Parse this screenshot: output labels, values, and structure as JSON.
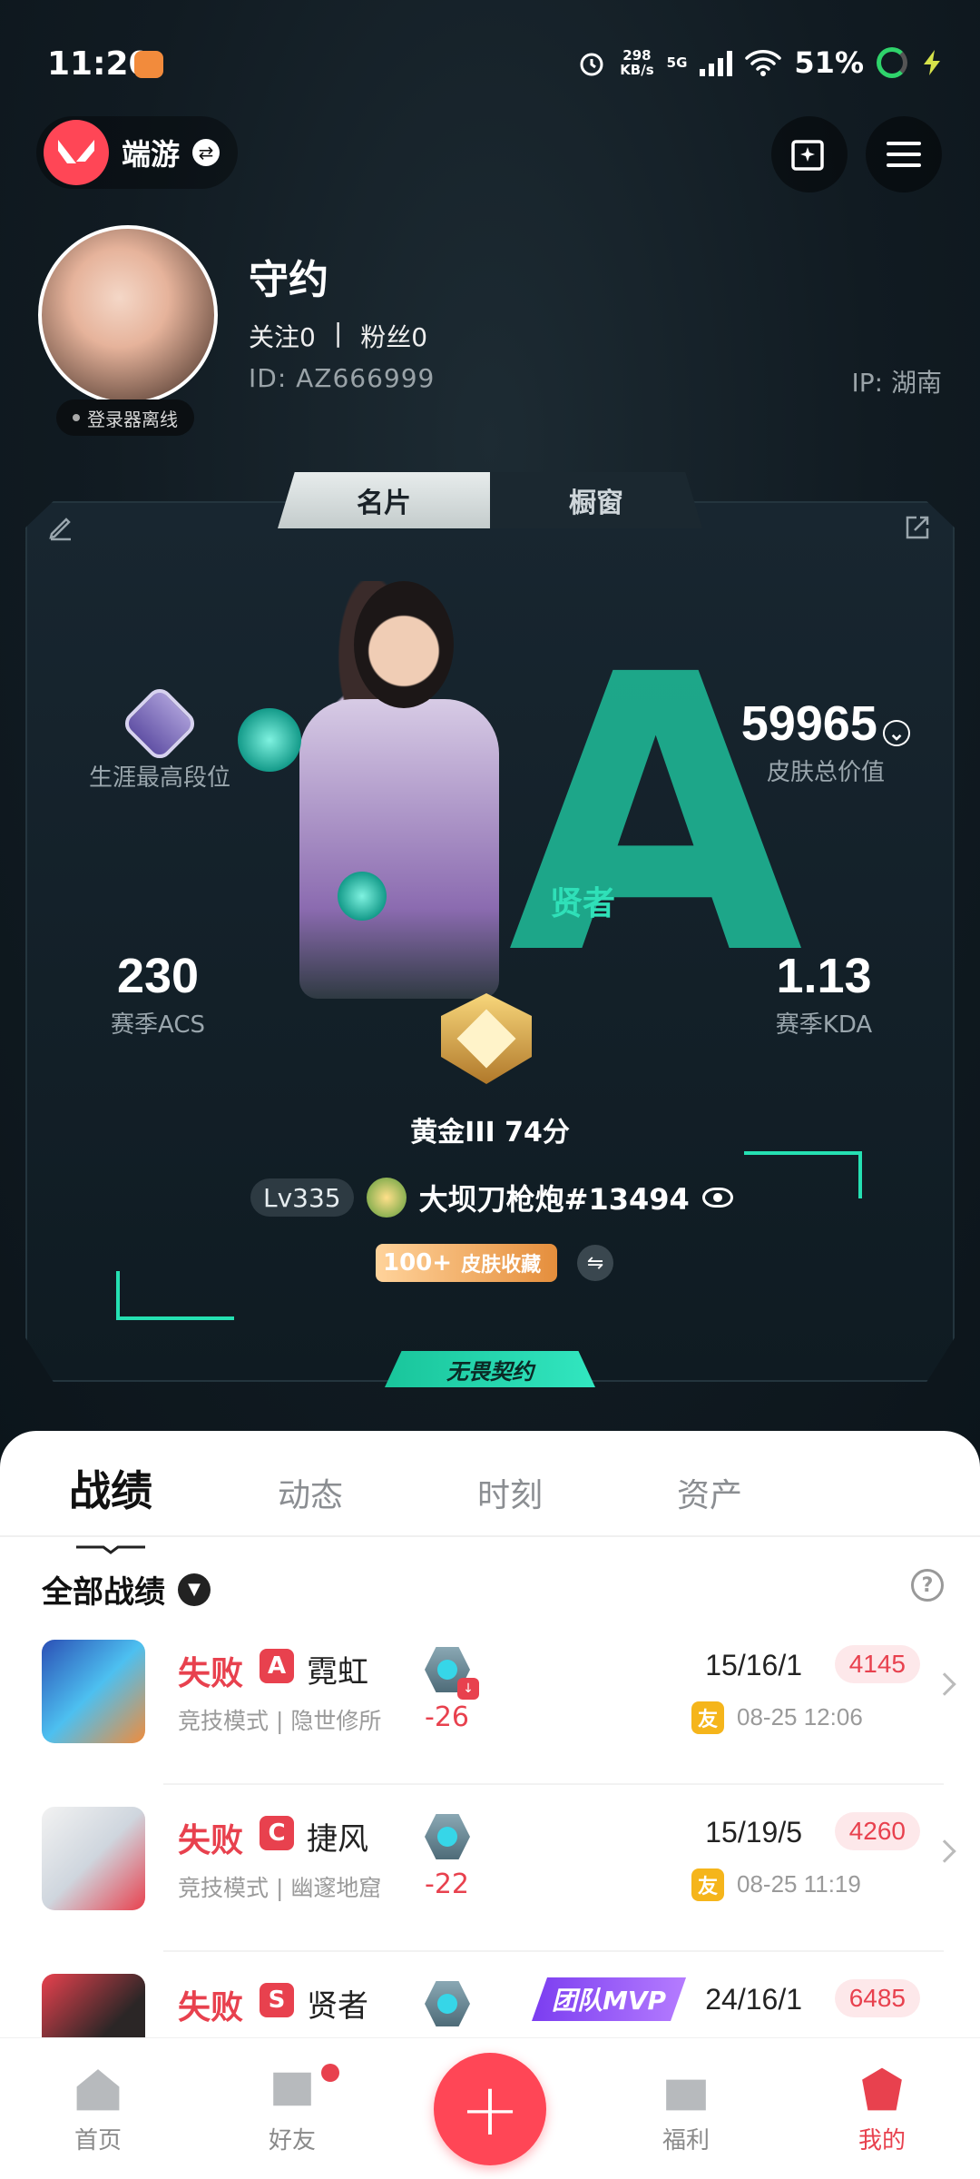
{
  "status_bar": {
    "time": "11:20",
    "net_speed_top": "298",
    "net_speed_unit": "KB/s",
    "network": "5G",
    "battery": "51%"
  },
  "header": {
    "brand_text": "端游",
    "accent_color": "#ff4656"
  },
  "profile": {
    "username": "守约",
    "following_label": "关注0",
    "separator": "|",
    "followers_label": "粉丝0",
    "id_text": "ID:  AZ666999",
    "ip_text": "IP:  湖南",
    "login_status": "登录器离线"
  },
  "card_tabs": [
    "名片",
    "橱窗"
  ],
  "card": {
    "agent_role_label": "贤者",
    "peak_rank_label": "生涯最高段位",
    "skin_value": "59965",
    "skin_value_label": "皮肤总价值",
    "acs_value": "230",
    "acs_label": "赛季ACS",
    "kda_value": "1.13",
    "kda_label": "赛季KDA",
    "rank_text": "黄金III 74分",
    "level": "Lv335",
    "player_name": "大坝刀枪炮#13494",
    "skin_badge_num": "100+",
    "skin_badge_text": "皮肤收藏",
    "contract_label": "无畏契约"
  },
  "panel": {
    "tabs": [
      "战绩",
      "动态",
      "时刻",
      "资产"
    ],
    "filter_label": "全部战绩",
    "matches": [
      {
        "result": "失败",
        "grade": "A",
        "agent": "霓虹",
        "mode": "竞技模式 | 隐世修所",
        "delta": "-26",
        "kda": "15/16/1",
        "acs": "4145",
        "friend_tag": "友",
        "date": "08-25 12:06"
      },
      {
        "result": "失败",
        "grade": "C",
        "agent": "捷风",
        "mode": "竞技模式 | 幽邃地窟",
        "delta": "-22",
        "kda": "15/19/5",
        "acs": "4260",
        "friend_tag": "友",
        "date": "08-25 11:19"
      },
      {
        "result": "失败",
        "grade": "S",
        "agent": "贤者",
        "mvp": "团队MVP",
        "kda": "24/16/1",
        "acs": "6485"
      }
    ]
  },
  "bottom_nav": {
    "items": [
      "首页",
      "好友",
      "福利",
      "我的"
    ]
  }
}
